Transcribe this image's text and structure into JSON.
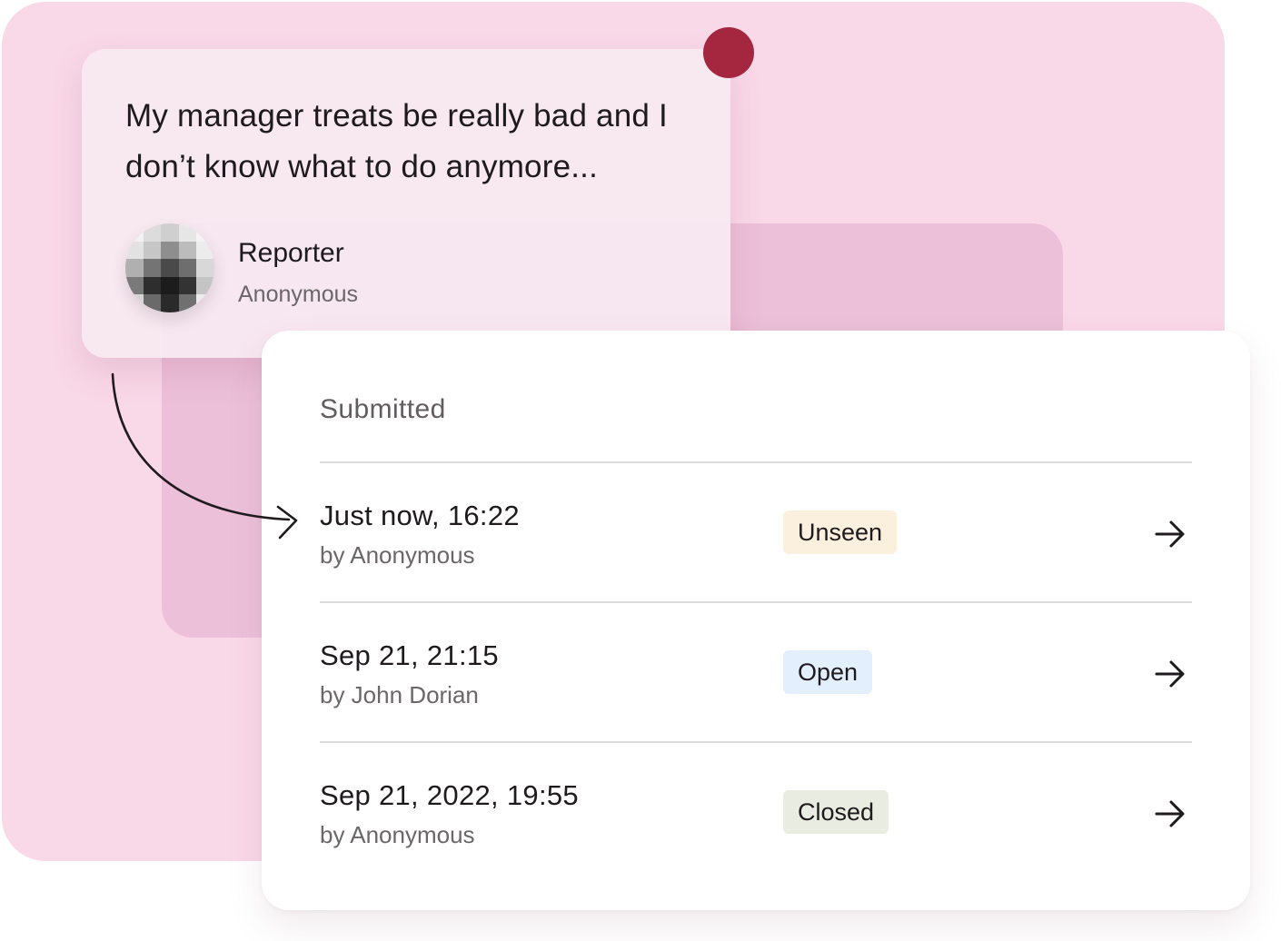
{
  "report": {
    "message": "My manager treats be really bad and I don’t know what to do anymore...",
    "reporter_label": "Reporter",
    "reporter_name": "Anonymous"
  },
  "submissions": {
    "heading": "Submitted",
    "rows": [
      {
        "title": "Just now, 16:22",
        "author": "by Anonymous",
        "status": "Unseen",
        "status_color": "#fbf0de"
      },
      {
        "title": "Sep 21, 21:15",
        "author": "by John Dorian",
        "status": "Open",
        "status_color": "#e4effd"
      },
      {
        "title": "Sep 21, 2022, 19:55",
        "author": "by Anonymous",
        "status": "Closed",
        "status_color": "#e9ece1"
      }
    ]
  },
  "icons": {
    "row_action": "arrow-right-icon",
    "connector": "curved-arrow-icon",
    "notification": "red-dot-icon"
  },
  "colors": {
    "background": "#f9d8e8",
    "accent_dot": "#a4263f"
  }
}
